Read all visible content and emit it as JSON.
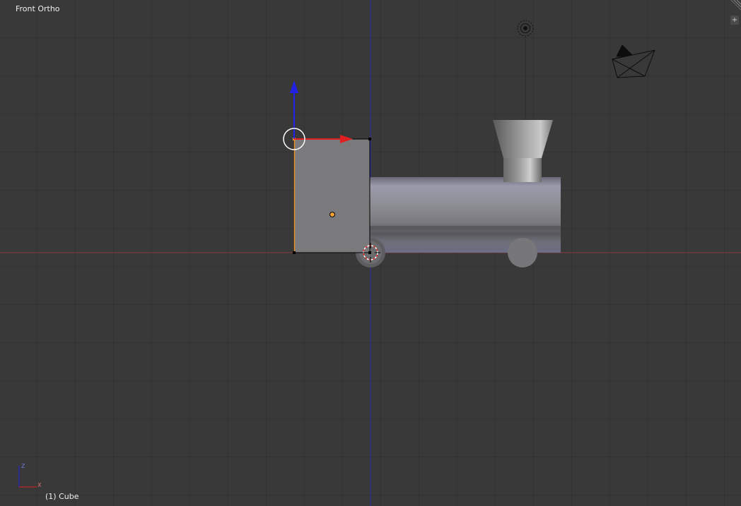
{
  "viewport": {
    "view_label": "Front Ortho",
    "object_label": "(1) Cube",
    "corner_button": "+",
    "axis_labels": {
      "x": "X",
      "z": "Z"
    }
  },
  "colors": {
    "background": "#393939",
    "grid": "#333333",
    "x_axis": "#b03a3a",
    "z_axis": "#2b2bd6",
    "selected_edge": "#e8922a",
    "selected_object": "#7a7a7c"
  },
  "icons": [
    "lamp-icon",
    "camera-icon",
    "axis-gizmo-icon",
    "3d-cursor-icon",
    "origin-dot-icon",
    "add-region-icon"
  ]
}
